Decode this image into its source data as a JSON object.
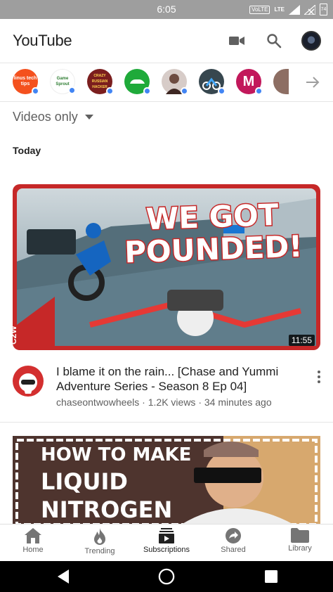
{
  "status_bar": {
    "time": "6:05",
    "volte": "VoLTE",
    "network": "LTE",
    "battery": "74"
  },
  "app_bar": {
    "title": "YouTube"
  },
  "channels": [
    {
      "name": "linus tech tips",
      "label": "linus tech tips",
      "color": "#f4511e",
      "new": true
    },
    {
      "name": "Game Sprout",
      "label": "Game Sprout",
      "color": "#ffffff",
      "new": true
    },
    {
      "name": "Crazy Russian Hacker",
      "label": "CRAZY RUSSIAN HACKER",
      "color": "#7b1e1e",
      "new": true
    },
    {
      "name": "Car channel",
      "label": "",
      "color": "#1faa3a",
      "new": true
    },
    {
      "name": "Portrait channel",
      "label": "",
      "color": "#d7ccc8",
      "new": true
    },
    {
      "name": "Motorcycle channel",
      "label": "",
      "color": "#37474f",
      "new": true
    },
    {
      "name": "M channel",
      "label": "M",
      "color": "#c2185b",
      "new": true
    },
    {
      "name": "Partial channel",
      "label": "",
      "color": "#8d6e63",
      "new": false
    }
  ],
  "filter": {
    "label": "Videos only"
  },
  "section": {
    "title": "Today"
  },
  "videos": [
    {
      "thumb_text_1": "WE GOT",
      "thumb_text_2": "POUNDED!",
      "badge": "C2W",
      "duration": "11:55",
      "title": "I blame it on the rain... [Chase and Yummi Adventure Series - Season 8 Ep 04]",
      "channel": "chaseontwowheels",
      "views": "1.2K views",
      "age": "34 minutes ago",
      "subtitle": "chaseontwowheels · 1.2K views · 34 minutes ago"
    },
    {
      "thumb_text_1": "HOW TO MAKE",
      "thumb_text_2": "LIQUID",
      "thumb_text_3": "NITROGEN"
    }
  ],
  "bottom_nav": [
    {
      "label": "Home",
      "icon": "home-icon"
    },
    {
      "label": "Trending",
      "icon": "flame-icon"
    },
    {
      "label": "Subscriptions",
      "icon": "subscriptions-icon",
      "active": true
    },
    {
      "label": "Shared",
      "icon": "share-icon"
    },
    {
      "label": "Library",
      "icon": "folder-icon"
    }
  ],
  "colors": {
    "accent_red": "#c62828",
    "new_dot": "#4285f4",
    "inactive_icon": "#757575"
  }
}
